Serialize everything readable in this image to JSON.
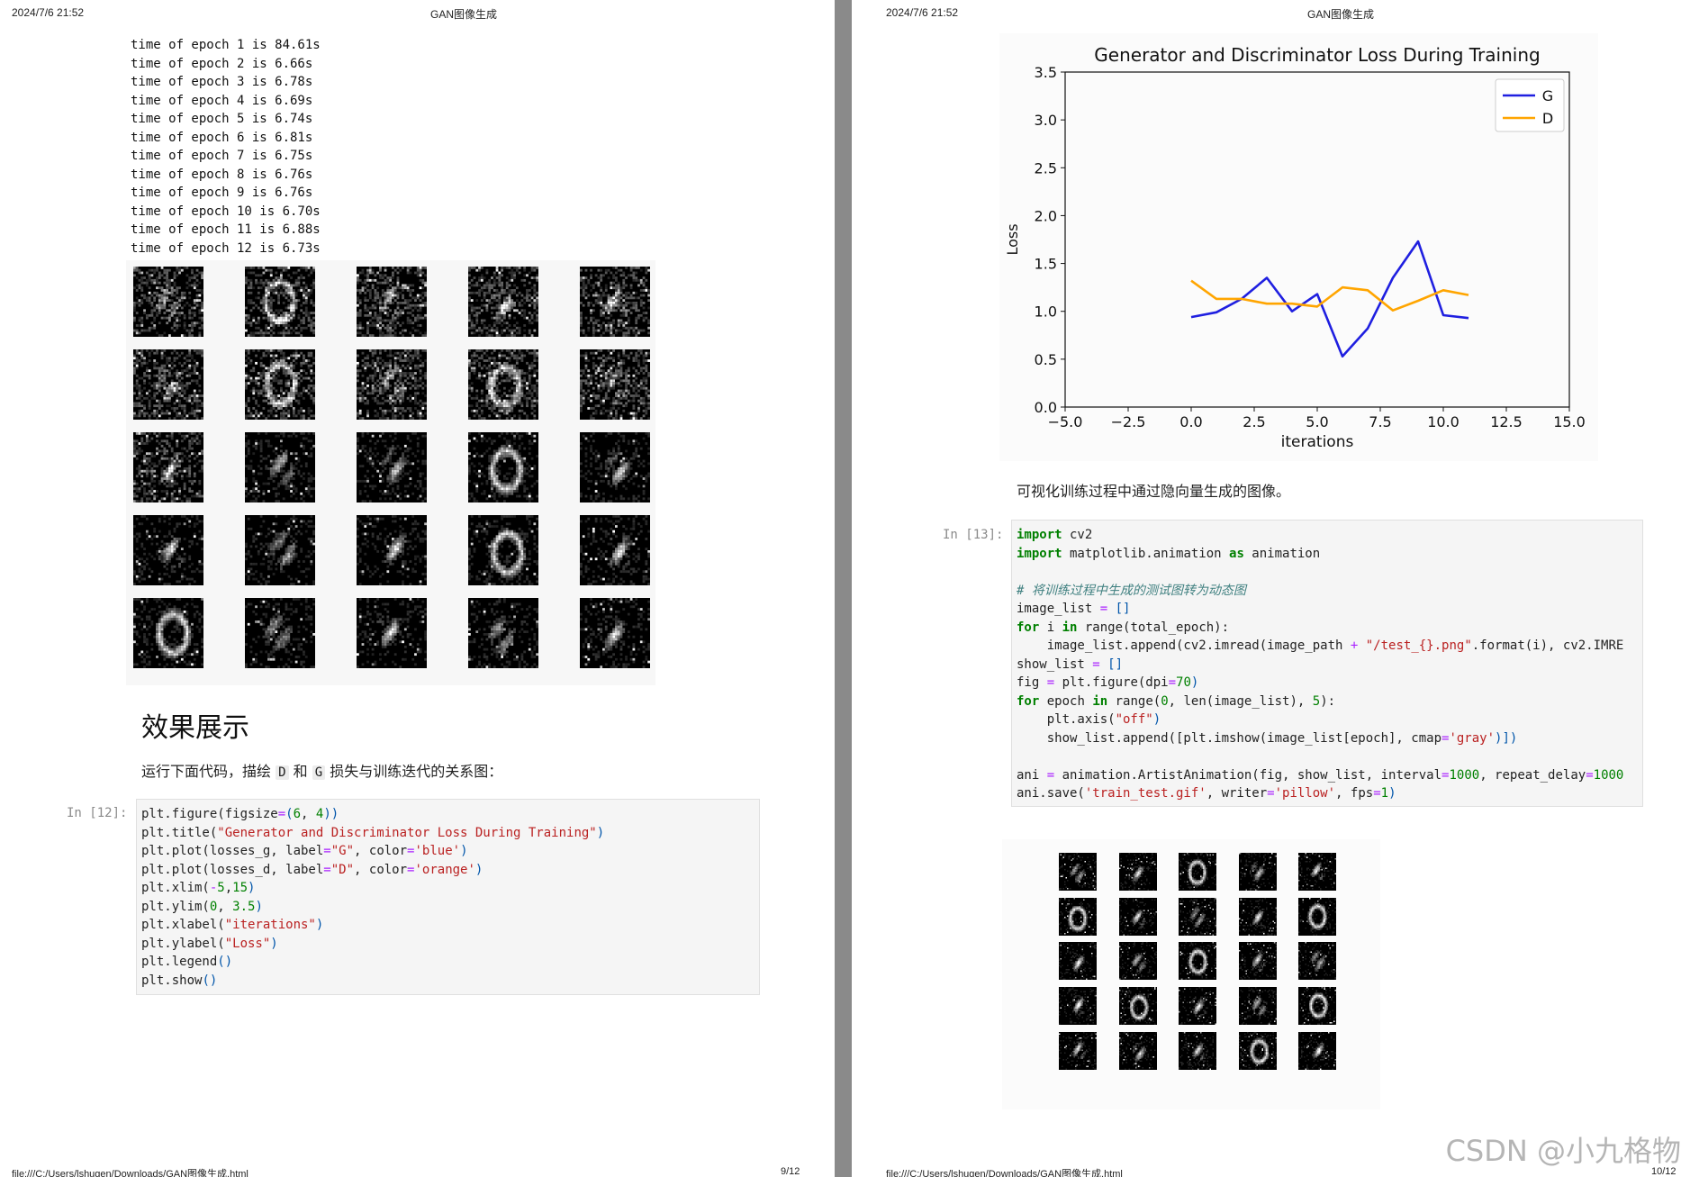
{
  "header": {
    "date": "2024/7/6 21:52",
    "title": "GAN图像生成"
  },
  "left": {
    "output_lines": [
      "time of epoch 1 is 84.61s",
      "time of epoch 2 is 6.66s",
      "time of epoch 3 is 6.78s",
      "time of epoch 4 is 6.69s",
      "time of epoch 5 is 6.74s",
      "time of epoch 6 is 6.81s",
      "time of epoch 7 is 6.75s",
      "time of epoch 8 is 6.76s",
      "time of epoch 9 is 6.76s",
      "time of epoch 10 is 6.70s",
      "time of epoch 11 is 6.88s",
      "time of epoch 12 is 6.73s"
    ],
    "heading": "效果展示",
    "para_prefix": "运行下面代码，描绘",
    "para_d": "D",
    "para_and": "和",
    "para_g": "G",
    "para_suffix": "损失与训练迭代的关系图：",
    "prompt": "In [12]:",
    "footer_path": "file:///C:/Users/lshugen/Downloads/GAN图像生成.html",
    "footer_page": "9/12"
  },
  "right": {
    "caption": "可视化训练过程中通过隐向量生成的图像。",
    "prompt": "In [13]:",
    "footer_path": "file:///C:/Users/lshugen/Downloads/GAN图像生成.html",
    "footer_page": "10/12"
  },
  "code12": [
    [
      [
        "plt.figure(figsize",
        "p"
      ],
      [
        "=",
        "o"
      ],
      [
        "(",
        "b"
      ],
      [
        "6",
        "n"
      ],
      [
        ", ",
        "p"
      ],
      [
        "4",
        "n"
      ],
      [
        "))",
        "b"
      ]
    ],
    [
      [
        "plt.title(",
        "p"
      ],
      [
        "\"Generator and Discriminator Loss During Training\"",
        "s"
      ],
      [
        ")",
        "b"
      ]
    ],
    [
      [
        "plt.plot(losses_g, label",
        "p"
      ],
      [
        "=",
        "o"
      ],
      [
        "\"G\"",
        "s"
      ],
      [
        ", color",
        "p"
      ],
      [
        "=",
        "o"
      ],
      [
        "'blue'",
        "s"
      ],
      [
        ")",
        "b"
      ]
    ],
    [
      [
        "plt.plot(losses_d, label",
        "p"
      ],
      [
        "=",
        "o"
      ],
      [
        "\"D\"",
        "s"
      ],
      [
        ", color",
        "p"
      ],
      [
        "=",
        "o"
      ],
      [
        "'orange'",
        "s"
      ],
      [
        ")",
        "b"
      ]
    ],
    [
      [
        "plt.xlim(",
        "p"
      ],
      [
        "-",
        "o"
      ],
      [
        "5",
        "n"
      ],
      [
        ",",
        "p"
      ],
      [
        "15",
        "n"
      ],
      [
        ")",
        "b"
      ]
    ],
    [
      [
        "plt.ylim(",
        "p"
      ],
      [
        "0",
        "n"
      ],
      [
        ", ",
        "p"
      ],
      [
        "3.5",
        "n"
      ],
      [
        ")",
        "b"
      ]
    ],
    [
      [
        "plt.xlabel(",
        "p"
      ],
      [
        "\"iterations\"",
        "s"
      ],
      [
        ")",
        "b"
      ]
    ],
    [
      [
        "plt.ylabel(",
        "p"
      ],
      [
        "\"Loss\"",
        "s"
      ],
      [
        ")",
        "b"
      ]
    ],
    [
      [
        "plt.legend",
        "p"
      ],
      [
        "()",
        "b"
      ]
    ],
    [
      [
        "plt.show",
        "p"
      ],
      [
        "()",
        "b"
      ]
    ]
  ],
  "code13": [
    [
      [
        "import",
        "k"
      ],
      [
        " cv2",
        "p"
      ]
    ],
    [
      [
        "import",
        "k"
      ],
      [
        " matplotlib.animation ",
        "p"
      ],
      [
        "as",
        "k"
      ],
      [
        " animation",
        "p"
      ]
    ],
    [],
    [
      [
        "# 将训练过程中生成的测试图转为动态图",
        "c"
      ]
    ],
    [
      [
        "image_list ",
        "p"
      ],
      [
        "=",
        "o"
      ],
      [
        " []",
        "b"
      ]
    ],
    [
      [
        "for",
        "k"
      ],
      [
        " i ",
        "p"
      ],
      [
        "in",
        "k"
      ],
      [
        " range(total_epoch):",
        "p"
      ]
    ],
    [
      [
        "    image_list.append(cv2.imread(image_path ",
        "p"
      ],
      [
        "+",
        "o"
      ],
      [
        " \"/test_{}.png\"",
        "s"
      ],
      [
        ".format(i), cv2.IMRE",
        "p"
      ]
    ],
    [
      [
        "show_list ",
        "p"
      ],
      [
        "=",
        "o"
      ],
      [
        " []",
        "b"
      ]
    ],
    [
      [
        "fig ",
        "p"
      ],
      [
        "=",
        "o"
      ],
      [
        " plt.figure(dpi",
        "p"
      ],
      [
        "=",
        "o"
      ],
      [
        "70",
        "n"
      ],
      [
        ")",
        "b"
      ]
    ],
    [
      [
        "for",
        "k"
      ],
      [
        " epoch ",
        "p"
      ],
      [
        "in",
        "k"
      ],
      [
        " range(",
        "p"
      ],
      [
        "0",
        "n"
      ],
      [
        ", len(image_list), ",
        "p"
      ],
      [
        "5",
        "n"
      ],
      [
        "):",
        "p"
      ]
    ],
    [
      [
        "    plt.axis(",
        "p"
      ],
      [
        "\"off\"",
        "s"
      ],
      [
        ")",
        "b"
      ]
    ],
    [
      [
        "    show_list.append([plt.imshow(image_list[epoch], cmap",
        "p"
      ],
      [
        "=",
        "o"
      ],
      [
        "'gray'",
        "s"
      ],
      [
        ")])",
        "b"
      ]
    ],
    [],
    [
      [
        "ani ",
        "p"
      ],
      [
        "=",
        "o"
      ],
      [
        " animation.ArtistAnimation(fig, show_list, interval",
        "p"
      ],
      [
        "=",
        "o"
      ],
      [
        "1000",
        "n"
      ],
      [
        ", repeat_delay",
        "p"
      ],
      [
        "=",
        "o"
      ],
      [
        "1000",
        "n"
      ]
    ],
    [
      [
        "ani.save(",
        "p"
      ],
      [
        "'train_test.gif'",
        "s"
      ],
      [
        ", writer",
        "p"
      ],
      [
        "=",
        "o"
      ],
      [
        "'pillow'",
        "s"
      ],
      [
        ", fps",
        "p"
      ],
      [
        "=",
        "o"
      ],
      [
        "1",
        "n"
      ],
      [
        ")",
        "b"
      ]
    ]
  ],
  "chart_data": {
    "type": "line",
    "title": "Generator and Discriminator Loss During Training",
    "xlabel": "iterations",
    "ylabel": "Loss",
    "xlim": [
      -5,
      15
    ],
    "ylim": [
      0,
      3.5
    ],
    "x_ticks": [
      "−5.0",
      "−2.5",
      "0.0",
      "2.5",
      "5.0",
      "7.5",
      "10.0",
      "12.5",
      "15.0"
    ],
    "y_ticks": [
      "0.0",
      "0.5",
      "1.0",
      "1.5",
      "2.0",
      "2.5",
      "3.0",
      "3.5"
    ],
    "grid": false,
    "legend_position": "top-right",
    "x": [
      0,
      1,
      2,
      3,
      4,
      5,
      6,
      7,
      8,
      9,
      10,
      11
    ],
    "series": [
      {
        "name": "G",
        "color": "#1f1fe0",
        "values": [
          0.94,
          0.99,
          1.13,
          1.35,
          1.0,
          1.18,
          0.53,
          0.82,
          1.35,
          1.73,
          0.96,
          0.93
        ]
      },
      {
        "name": "D",
        "color": "#ffa500",
        "values": [
          1.32,
          1.13,
          1.13,
          1.08,
          1.08,
          1.05,
          1.25,
          1.22,
          1.01,
          1.11,
          1.22,
          1.17
        ]
      }
    ]
  },
  "watermark": "CSDN @小九格物"
}
